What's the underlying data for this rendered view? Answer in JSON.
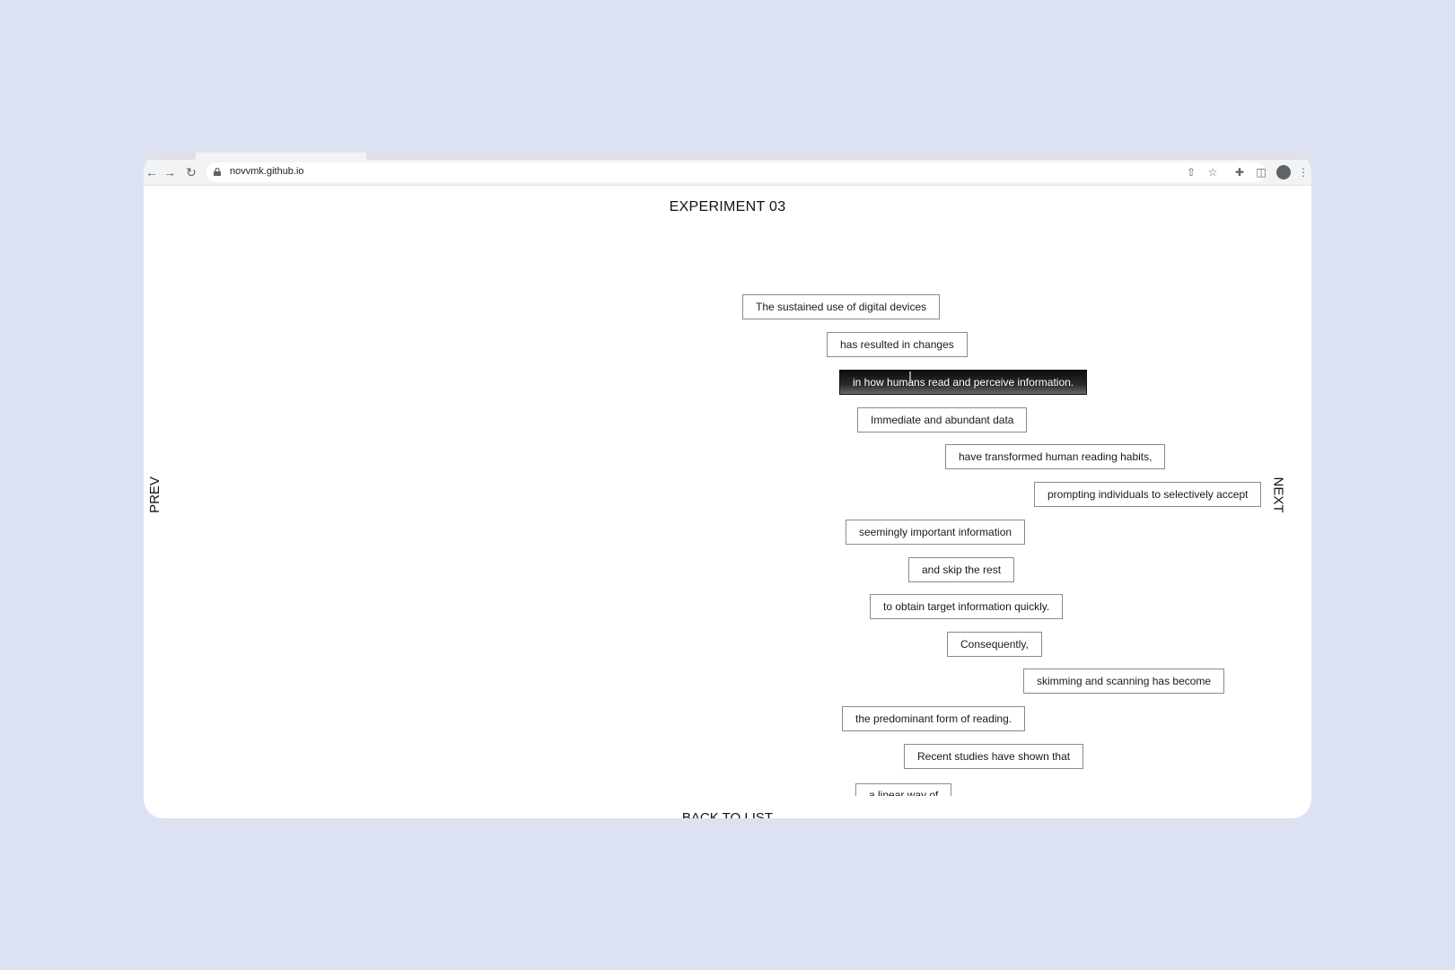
{
  "browser": {
    "url": "novvmk.github.io",
    "nav_icons": [
      "back-arrow-icon",
      "forward-arrow-icon",
      "reload-icon"
    ],
    "toolbar_icons": [
      "share-icon",
      "star-icon",
      "extensions-icon",
      "sidebar-icon",
      "profile-icon",
      "more-menu-icon"
    ]
  },
  "page": {
    "title": "EXPERIMENT 03",
    "prev_label": "PREV",
    "next_label": "NEXT",
    "back_label": "BACK TO LIST"
  },
  "phrases": [
    "The sustained use of digital devices",
    "has resulted in changes",
    "in how humans read and perceive information.",
    "Immediate and abundant data",
    "have transformed human reading habits,",
    "prompting individuals to selectively accept",
    "seemingly important information",
    "and skip the rest",
    "to obtain target information quickly.",
    "Consequently,",
    "skimming and scanning has become",
    "the predominant form of reading.",
    "Recent studies have shown that",
    "a linear way of"
  ],
  "active_phrase_index": 2,
  "colors": {
    "background": "#dde2f2",
    "window": "#ffffff",
    "active_phrase": "#111111"
  }
}
